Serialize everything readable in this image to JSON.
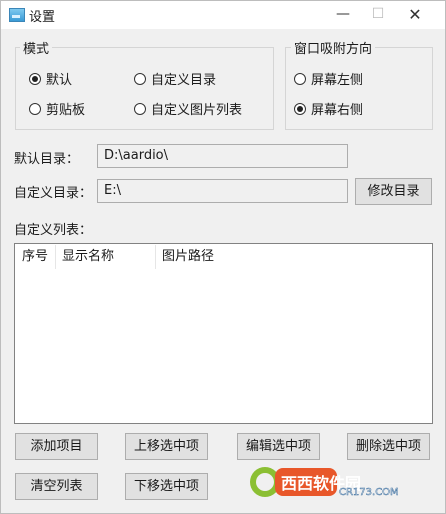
{
  "window": {
    "title": "设置",
    "min": "—",
    "max": "☐",
    "close": "✕"
  },
  "mode_group": {
    "title": "模式",
    "options": [
      {
        "label": "默认",
        "checked": true
      },
      {
        "label": "自定义目录",
        "checked": false
      },
      {
        "label": "剪贴板",
        "checked": false
      },
      {
        "label": "自定义图片列表",
        "checked": false
      }
    ]
  },
  "dock_group": {
    "title": "窗口吸附方向",
    "options": [
      {
        "label": "屏幕左侧",
        "checked": false
      },
      {
        "label": "屏幕右侧",
        "checked": true
      }
    ]
  },
  "fields": {
    "default_dir_label": "默认目录：",
    "default_dir_value": "D:\\aardio\\",
    "custom_dir_label": "自定义目录：",
    "custom_dir_value": "E:\\",
    "modify_button": "修改目录",
    "custom_list_label": "自定义列表："
  },
  "listview": {
    "columns": [
      "序号",
      "显示名称",
      "图片路径"
    ]
  },
  "buttons": {
    "add": "添加项目",
    "move_up": "上移选中项",
    "edit": "编辑选中项",
    "delete": "删除选中项",
    "clear": "清空列表",
    "move_down": "下移选中项"
  },
  "watermark": {
    "text1": "西西软件园",
    "text2": "CR173.COM"
  }
}
